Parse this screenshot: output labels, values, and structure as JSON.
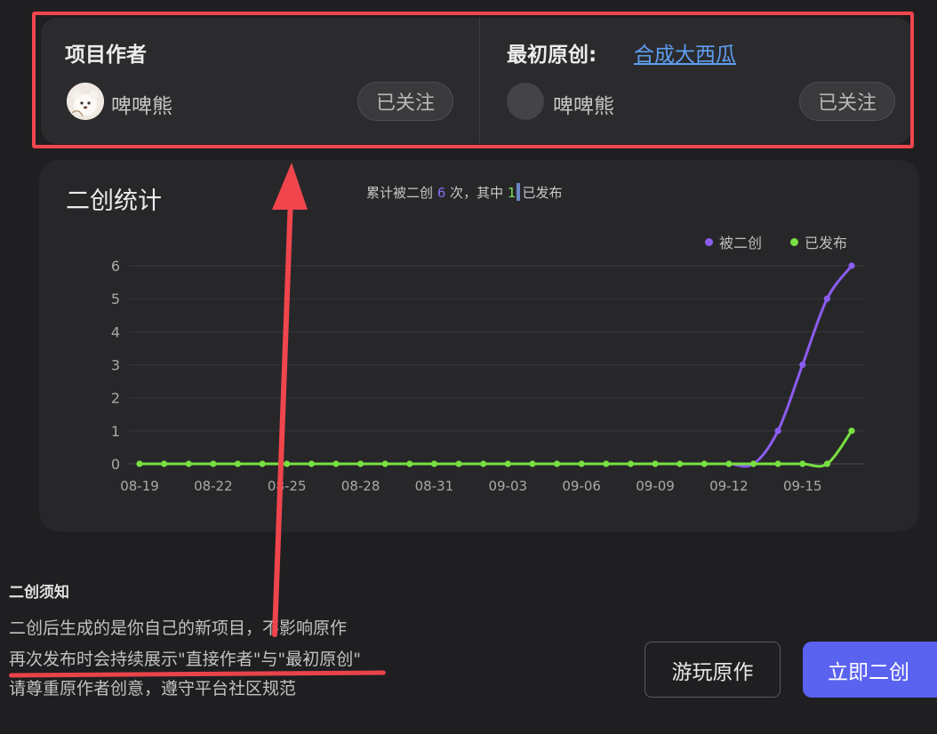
{
  "project_author": {
    "heading": "项目作者",
    "name": "啤啤熊",
    "follow_label": "已关注"
  },
  "original_author": {
    "heading": "最初原创:",
    "project_link": "合成大西瓜",
    "name": "啤啤熊",
    "follow_label": "已关注"
  },
  "stats": {
    "title": "二创统计",
    "summary_prefix": "累计被二创",
    "remix_count": "6",
    "summary_middle": "次，其中",
    "published_count": "1",
    "summary_suffix": "已发布"
  },
  "chart_data": {
    "type": "line",
    "x": [
      "08-19",
      "08-20",
      "08-21",
      "08-22",
      "08-23",
      "08-24",
      "08-25",
      "08-26",
      "08-27",
      "08-28",
      "08-29",
      "08-30",
      "08-31",
      "09-01",
      "09-02",
      "09-03",
      "09-04",
      "09-05",
      "09-06",
      "09-07",
      "09-08",
      "09-09",
      "09-10",
      "09-11",
      "09-12",
      "09-13",
      "09-14",
      "09-15",
      "09-16",
      "09-17"
    ],
    "tick_labels": [
      "08-19",
      "08-22",
      "08-25",
      "08-28",
      "08-31",
      "09-03",
      "09-06",
      "09-09",
      "09-12",
      "09-15"
    ],
    "series": [
      {
        "name": "被二创",
        "color": "#8c5cf0",
        "values": [
          0,
          0,
          0,
          0,
          0,
          0,
          0,
          0,
          0,
          0,
          0,
          0,
          0,
          0,
          0,
          0,
          0,
          0,
          0,
          0,
          0,
          0,
          0,
          0,
          0,
          0,
          1,
          3,
          5,
          6
        ]
      },
      {
        "name": "已发布",
        "color": "#78e040",
        "values": [
          0,
          0,
          0,
          0,
          0,
          0,
          0,
          0,
          0,
          0,
          0,
          0,
          0,
          0,
          0,
          0,
          0,
          0,
          0,
          0,
          0,
          0,
          0,
          0,
          0,
          0,
          0,
          0,
          0,
          1
        ]
      }
    ],
    "y_ticks": [
      "0",
      "1",
      "2",
      "3",
      "4",
      "5",
      "6"
    ],
    "ylim": [
      0,
      6
    ],
    "grid": true,
    "legend_position": "top-right"
  },
  "notice": {
    "title": "二创须知",
    "lines": [
      "二创后生成的是你自己的新项目，不影响原作",
      "再次发布时会持续展示\"直接作者\"与\"最初原创\"",
      "请尊重原作者创意，遵守平台社区规范"
    ]
  },
  "actions": {
    "play_original": "游玩原作",
    "remix_now": "立即二创"
  },
  "colors": {
    "accent_button": "#5a62f0",
    "link": "#5e9ef0",
    "highlight_red": "#f0454c",
    "remix_series": "#8c5cf0",
    "published_series": "#78e040"
  }
}
